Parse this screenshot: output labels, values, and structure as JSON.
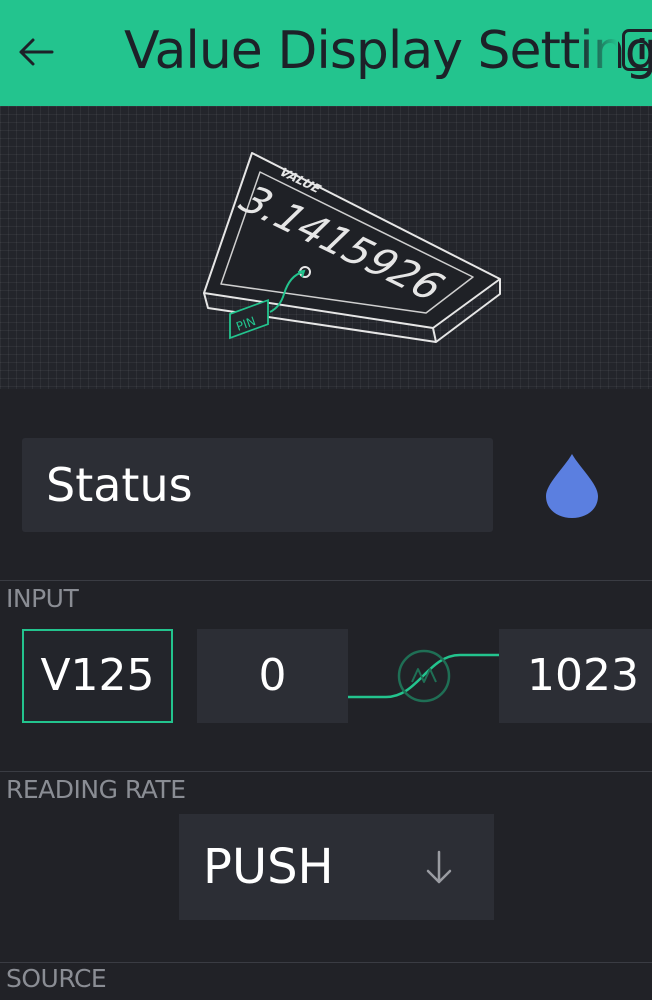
{
  "appbar": {
    "title": "Value Display Settings",
    "back_icon": "arrow-left-icon",
    "info_label": "i",
    "background": "#23c48e"
  },
  "hero": {
    "widget_caption": "VALUE",
    "widget_value": "3.1415926",
    "pin_caption": "PIN"
  },
  "widget_label": {
    "value": "Status"
  },
  "color_picker": {
    "icon": "drop-icon",
    "color": "#5b7fe0"
  },
  "input_section": {
    "label": "INPUT",
    "pin": "V125",
    "min": "0",
    "max": "1023",
    "map_icon": "mapping-icon",
    "accent": "#23c48e"
  },
  "reading_rate": {
    "label": "READING RATE",
    "value": "PUSH",
    "arrow_icon": "arrow-down-icon"
  },
  "source_section": {
    "label": "SOURCE"
  }
}
